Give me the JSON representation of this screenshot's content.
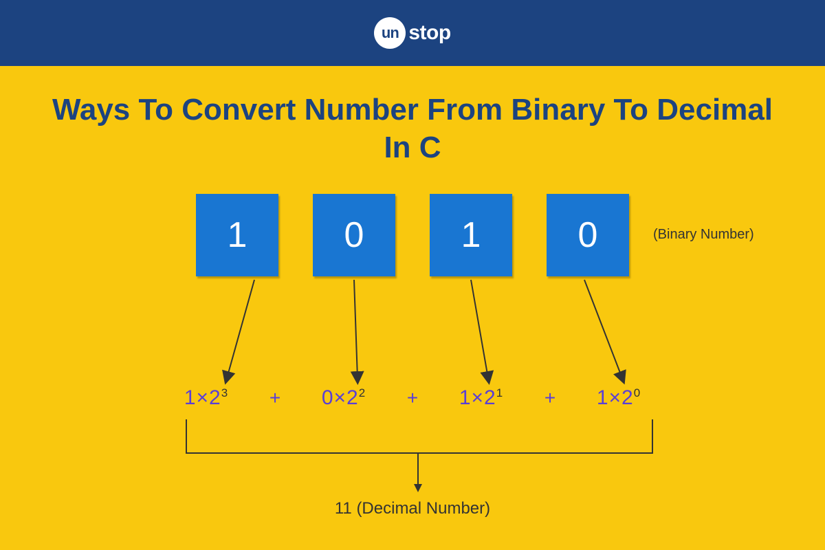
{
  "logo": {
    "circle": "un",
    "rest": "stop"
  },
  "title": "Ways To Convert Number From Binary To Decimal In C",
  "binary": {
    "bits": [
      "1",
      "0",
      "1",
      "0"
    ],
    "label": "(Binary Number)"
  },
  "formula": {
    "terms": [
      {
        "coef": "1",
        "base": "×2",
        "exp": "3"
      },
      {
        "coef": "0",
        "base": "×2",
        "exp": "2"
      },
      {
        "coef": "1",
        "base": "×2",
        "exp": "1"
      },
      {
        "coef": "1",
        "base": "×2",
        "exp": "0"
      }
    ],
    "plus": "+"
  },
  "result": {
    "value": "11",
    "label": "(Decimal Number)"
  }
}
